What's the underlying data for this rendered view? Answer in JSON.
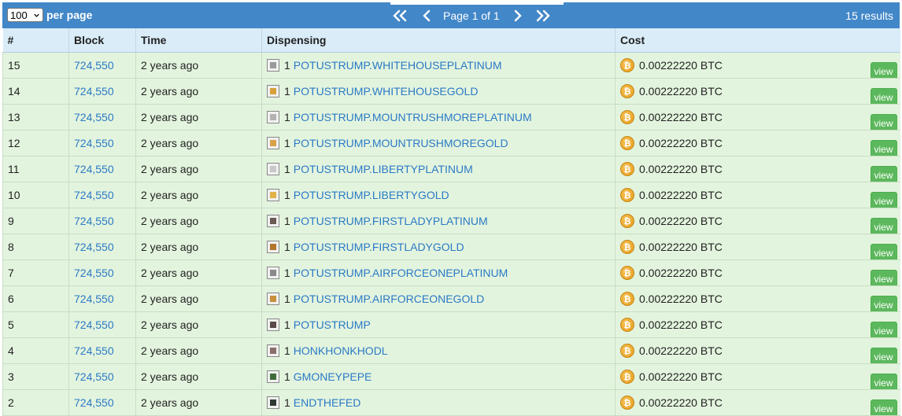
{
  "topbar": {
    "per_page_value": "100",
    "per_page_label": "per page",
    "page_text": "Page 1 of 1",
    "results": "15 results"
  },
  "columns": [
    "#",
    "Block",
    "Time",
    "Dispensing",
    "Cost"
  ],
  "rows": [
    {
      "num": "15",
      "block": "724,550",
      "time": "2 years ago",
      "qty": "1",
      "asset": "POTUSTRUMP.WHITEHOUSEPLATINUM",
      "icon": "whitehouse-platinum-icon",
      "icon_color": "#9a9a9a",
      "cost": "0.00222220 BTC",
      "view": "view"
    },
    {
      "num": "14",
      "block": "724,550",
      "time": "2 years ago",
      "qty": "1",
      "asset": "POTUSTRUMP.WHITEHOUSEGOLD",
      "icon": "whitehouse-gold-icon",
      "icon_color": "#d7a13a",
      "cost": "0.00222220 BTC",
      "view": "view"
    },
    {
      "num": "13",
      "block": "724,550",
      "time": "2 years ago",
      "qty": "1",
      "asset": "POTUSTRUMP.MOUNTRUSHMOREPLATINUM",
      "icon": "mountrushmore-platinum-icon",
      "icon_color": "#b3b3b3",
      "cost": "0.00222220 BTC",
      "view": "view"
    },
    {
      "num": "12",
      "block": "724,550",
      "time": "2 years ago",
      "qty": "1",
      "asset": "POTUSTRUMP.MOUNTRUSHMOREGOLD",
      "icon": "mountrushmore-gold-icon",
      "icon_color": "#d9a24a",
      "cost": "0.00222220 BTC",
      "view": "view"
    },
    {
      "num": "11",
      "block": "724,550",
      "time": "2 years ago",
      "qty": "1",
      "asset": "POTUSTRUMP.LIBERTYPLATINUM",
      "icon": "liberty-platinum-icon",
      "icon_color": "#c8c8c8",
      "cost": "0.00222220 BTC",
      "view": "view"
    },
    {
      "num": "10",
      "block": "724,550",
      "time": "2 years ago",
      "qty": "1",
      "asset": "POTUSTRUMP.LIBERTYGOLD",
      "icon": "liberty-gold-icon",
      "icon_color": "#e2b24a",
      "cost": "0.00222220 BTC",
      "view": "view"
    },
    {
      "num": "9",
      "block": "724,550",
      "time": "2 years ago",
      "qty": "1",
      "asset": "POTUSTRUMP.FIRSTLADYPLATINUM",
      "icon": "firstlady-platinum-icon",
      "icon_color": "#6b5a55",
      "cost": "0.00222220 BTC",
      "view": "view"
    },
    {
      "num": "8",
      "block": "724,550",
      "time": "2 years ago",
      "qty": "1",
      "asset": "POTUSTRUMP.FIRSTLADYGOLD",
      "icon": "firstlady-gold-icon",
      "icon_color": "#b3742d",
      "cost": "0.00222220 BTC",
      "view": "view"
    },
    {
      "num": "7",
      "block": "724,550",
      "time": "2 years ago",
      "qty": "1",
      "asset": "POTUSTRUMP.AIRFORCEONEPLATINUM",
      "icon": "airforceone-platinum-icon",
      "icon_color": "#8a8a8a",
      "cost": "0.00222220 BTC",
      "view": "view"
    },
    {
      "num": "6",
      "block": "724,550",
      "time": "2 years ago",
      "qty": "1",
      "asset": "POTUSTRUMP.AIRFORCEONEGOLD",
      "icon": "airforceone-gold-icon",
      "icon_color": "#c7913c",
      "cost": "0.00222220 BTC",
      "view": "view"
    },
    {
      "num": "5",
      "block": "724,550",
      "time": "2 years ago",
      "qty": "1",
      "asset": "POTUSTRUMP",
      "icon": "potustrump-icon",
      "icon_color": "#5a4a48",
      "cost": "0.00222220 BTC",
      "view": "view"
    },
    {
      "num": "4",
      "block": "724,550",
      "time": "2 years ago",
      "qty": "1",
      "asset": "HONKHONKHODL",
      "icon": "honkhonkhodl-icon",
      "icon_color": "#8a6f6a",
      "cost": "0.00222220 BTC",
      "view": "view"
    },
    {
      "num": "3",
      "block": "724,550",
      "time": "2 years ago",
      "qty": "1",
      "asset": "GMONEYPEPE",
      "icon": "gmoneypepe-icon",
      "icon_color": "#3f6b3a",
      "cost": "0.00222220 BTC",
      "view": "view"
    },
    {
      "num": "2",
      "block": "724,550",
      "time": "2 years ago",
      "qty": "1",
      "asset": "ENDTHEFED",
      "icon": "endthefed-icon",
      "icon_color": "#2f3a34",
      "cost": "0.00222220 BTC",
      "view": "view"
    }
  ],
  "colors": {
    "topbar": "#4287c8",
    "header_bg": "#d9ecf8",
    "row_bg": "#e3f4de",
    "link": "#2a7ac5",
    "view_button": "#5cb85c"
  }
}
